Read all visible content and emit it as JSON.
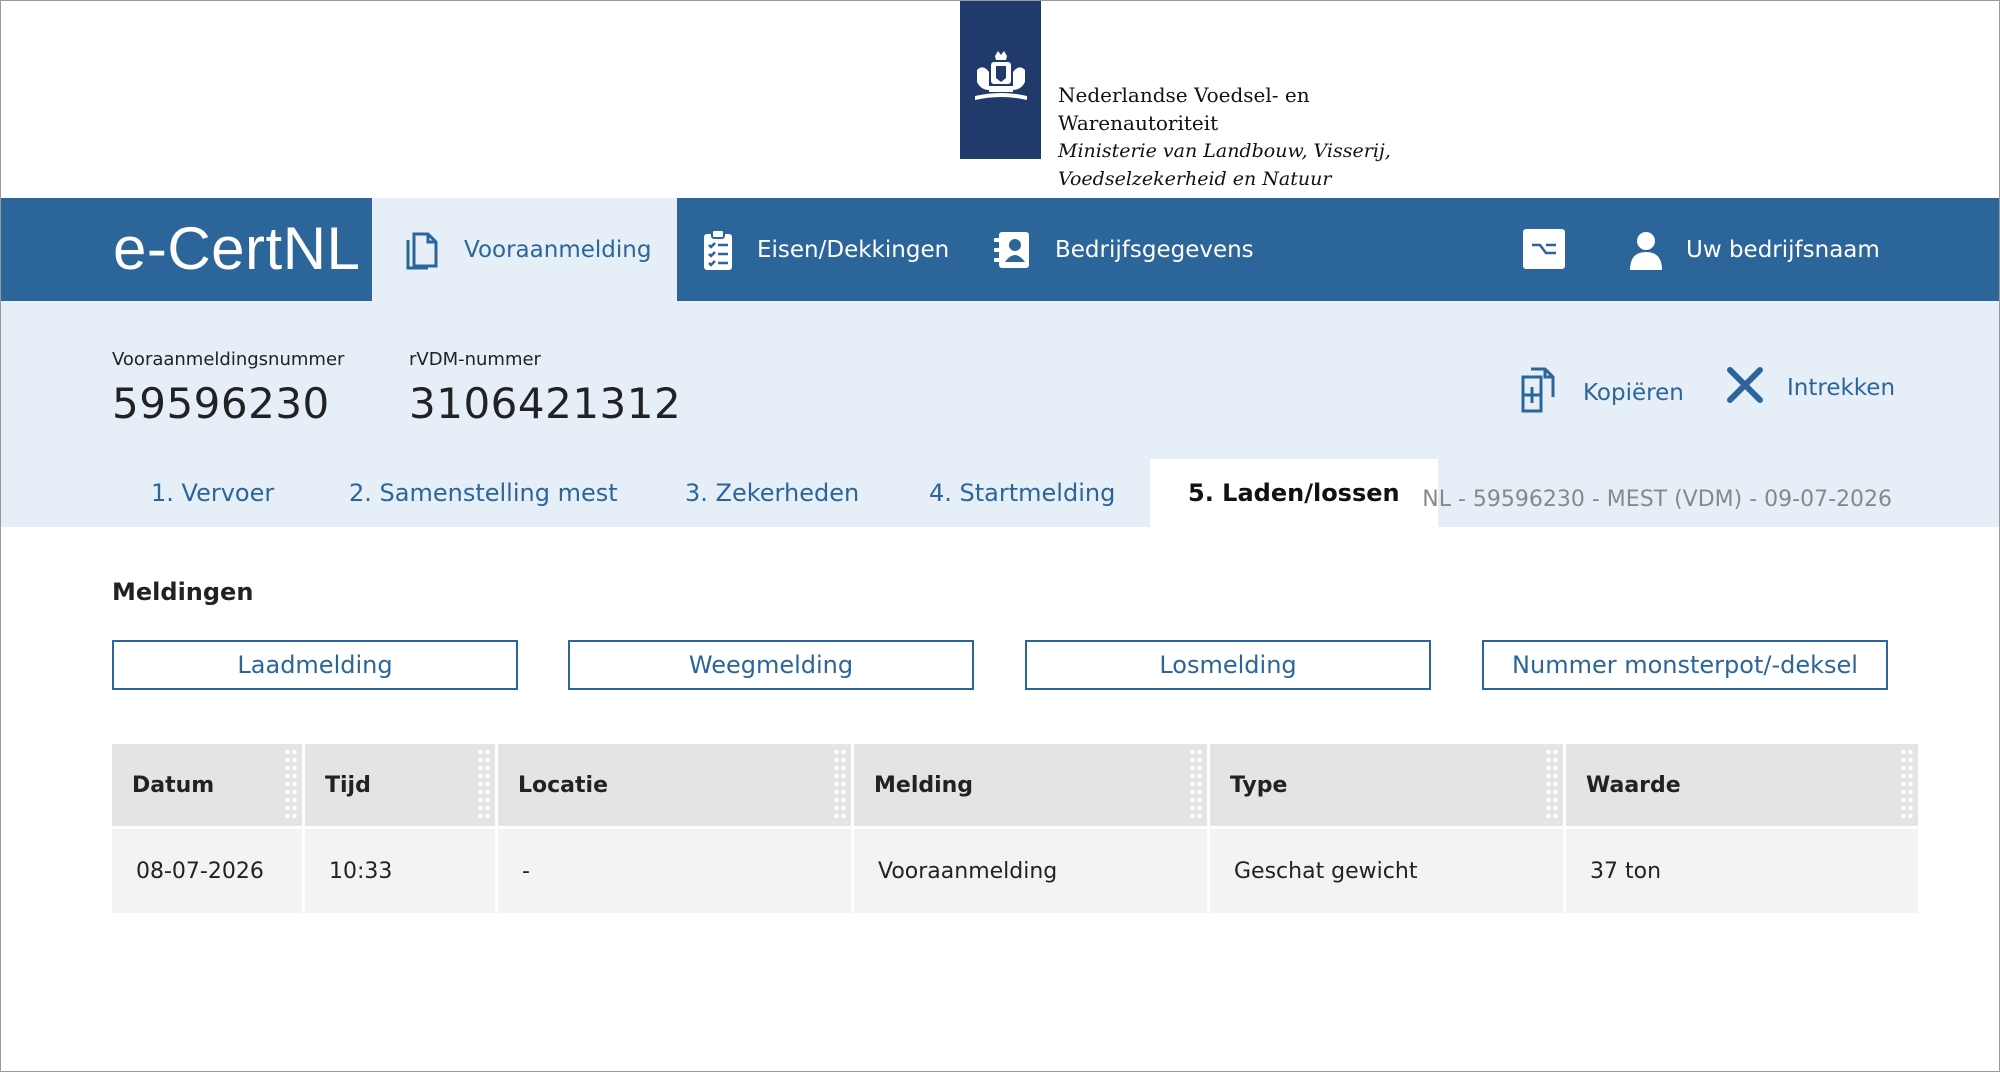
{
  "logo": {
    "line1": "Nederlandse Voedsel- en",
    "line2": "Warenautoriteit",
    "line3": "Ministerie van Landbouw, Visserij,",
    "line4": "Voedselzekerheid en Natuur"
  },
  "nav": {
    "brand": "e-CertNL",
    "items": [
      {
        "label": "Vooraanmelding",
        "icon": "document-copy-icon",
        "active": true
      },
      {
        "label": "Eisen/Dekkingen",
        "icon": "clipboard-checklist-icon"
      },
      {
        "label": "Bedrijfsgegevens",
        "icon": "contact-card-icon"
      }
    ],
    "switch_icon": "switch-icon",
    "account_label": "Uw bedrijfsnaam",
    "account_icon": "user-icon"
  },
  "header": {
    "preregistration_label": "Vooraanmeldingsnummer",
    "preregistration_value": "59596230",
    "rvdm_label": "rVDM-nummer",
    "rvdm_value": "3106421312",
    "copy_label": "Kopiëren",
    "withdraw_label": "Intrekken",
    "reference": "NL - 59596230 - MEST (VDM) - 09-07-2026"
  },
  "tabs": [
    {
      "label": "1. Vervoer"
    },
    {
      "label": "2. Samenstelling mest"
    },
    {
      "label": "3. Zekerheden"
    },
    {
      "label": "4. Startmelding"
    },
    {
      "label": "5. Laden/lossen",
      "active": true
    }
  ],
  "main": {
    "section_title": "Meldingen",
    "buttons": [
      "Laadmelding",
      "Weegmelding",
      "Losmelding",
      "Nummer monsterpot/-deksel"
    ]
  },
  "table": {
    "columns": [
      "Datum",
      "Tijd",
      "Locatie",
      "Melding",
      "Type",
      "Waarde"
    ],
    "rows": [
      [
        "08-07-2026",
        "10:33",
        "-",
        "Vooraanmelding",
        "Geschat gewicht",
        "37 ton"
      ]
    ]
  },
  "colors": {
    "nav": "#2c6599",
    "band": "#e6eff7",
    "logo": "#203a6b"
  }
}
